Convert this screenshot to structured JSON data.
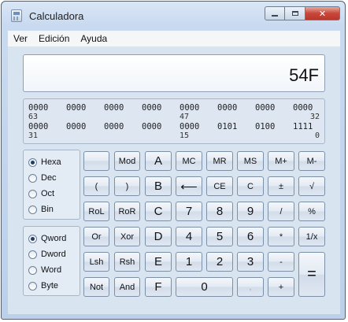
{
  "window": {
    "title": "Calculadora"
  },
  "menu": [
    "Ver",
    "Edición",
    "Ayuda"
  ],
  "display": {
    "value": "54F"
  },
  "binary": {
    "row1": [
      "0000",
      "0000",
      "0000",
      "0000",
      "0000",
      "0000",
      "0000",
      "0000"
    ],
    "row1_positions": [
      "63",
      "47",
      "32"
    ],
    "row2": [
      "0000",
      "0000",
      "0000",
      "0000",
      "0000",
      "0101",
      "0100",
      "1111"
    ],
    "row2_positions": [
      "31",
      "15",
      "0"
    ]
  },
  "number_system": {
    "options": [
      "Hexa",
      "Dec",
      "Oct",
      "Bin"
    ],
    "selected": "Hexa"
  },
  "word_size": {
    "options": [
      "Qword",
      "Dword",
      "Word",
      "Byte"
    ],
    "selected": "Qword"
  },
  "keys": {
    "blank": "",
    "mod": "Mod",
    "a": "A",
    "mc": "MC",
    "mr": "MR",
    "ms": "MS",
    "mplus": "M+",
    "mminus": "M-",
    "lparen": "(",
    "rparen": ")",
    "b": "B",
    "back": "⟵",
    "ce": "CE",
    "c": "C",
    "plusminus": "±",
    "sqrt": "√",
    "rol": "RoL",
    "ror": "RoR",
    "hc": "C",
    "seven": "7",
    "eight": "8",
    "nine": "9",
    "divide": "/",
    "percent": "%",
    "or": "Or",
    "xor": "Xor",
    "d": "D",
    "four": "4",
    "five": "5",
    "six": "6",
    "multiply": "*",
    "reciprocal": "1/x",
    "lsh": "Lsh",
    "rsh": "Rsh",
    "e": "E",
    "one": "1",
    "two": "2",
    "three": "3",
    "minus": "-",
    "equals": "=",
    "not": "Not",
    "and": "And",
    "f": "F",
    "zero": "0",
    "decimal": ",",
    "plus": "+"
  }
}
